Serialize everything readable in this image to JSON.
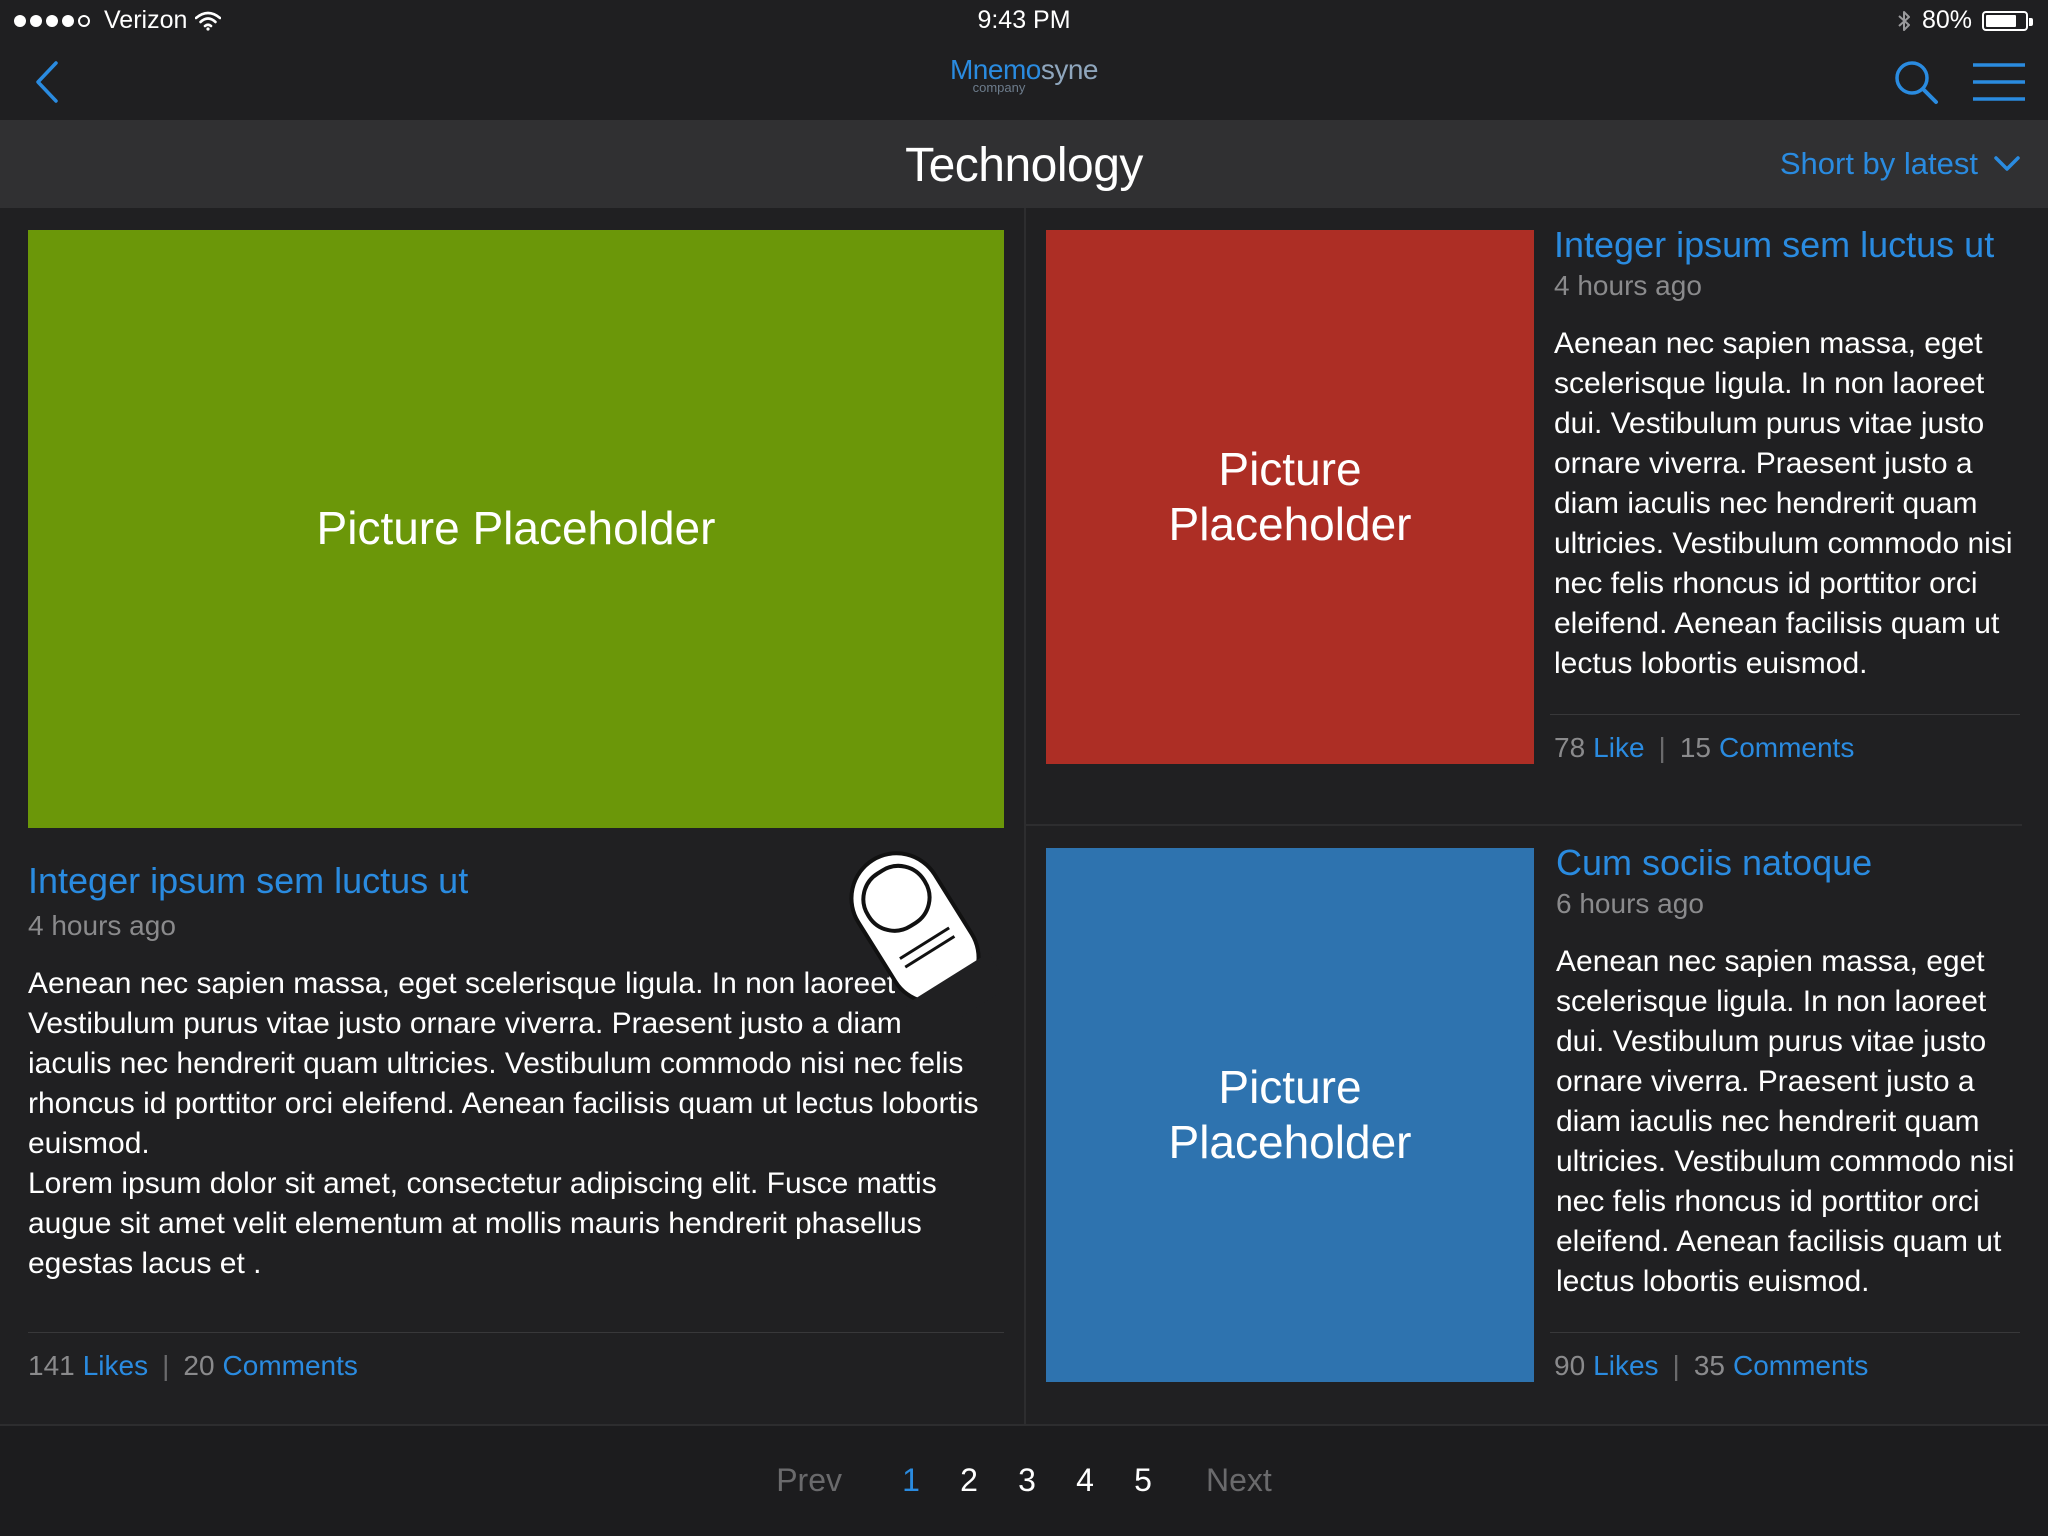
{
  "status_bar": {
    "carrier": "Verizon",
    "time": "9:43 PM",
    "battery": "80%",
    "battery_level": 0.8,
    "signal_bars_filled": 4,
    "icons": [
      "signal-dots-icon",
      "wifi-icon",
      "bluetooth-icon",
      "battery-icon"
    ]
  },
  "nav": {
    "logo_part1": "Mnemo",
    "logo_part2": "syne",
    "logo_sub": "company",
    "icons": [
      "back-chevron-icon",
      "search-icon",
      "hamburger-menu-icon"
    ]
  },
  "section": {
    "title": "Technology",
    "sort_label": "Short by latest",
    "sort_icon": "chevron-down-icon"
  },
  "featured": {
    "placeholder": "Picture Placeholder",
    "title": "Integer ipsum sem luctus ut",
    "time": "4 hours ago",
    "body1": "Aenean nec sapien massa, eget scelerisque ligula. In non laoreet Vestibulum purus vitae justo ornare viverra. Praesent justo a diam iaculis nec hendrerit quam ultricies. Vestibulum commodo nisi nec felis rhoncus id porttitor orci eleifend. Aenean facilisis quam ut lectus lobortis euismod.",
    "body2": "Lorem ipsum dolor sit amet, consectetur adipiscing elit. Fusce mattis augue sit amet velit elementum at mollis mauris hendrerit phasellus egestas lacus et .",
    "likes_count": "141",
    "likes_label": "Likes",
    "comments_count": "20",
    "comments_label": "Comments",
    "color": "#6b9709"
  },
  "articles": [
    {
      "placeholder": "Picture Placeholder",
      "title": "Integer ipsum sem luctus ut",
      "time": "4 hours ago",
      "body": "Aenean nec sapien massa, eget scelerisque ligula. In non laoreet dui. Vestibulum purus vitae justo ornare viverra. Praesent justo a diam iaculis nec hendrerit quam ultricies. Vestibulum commodo nisi nec felis rhoncus id porttitor orci eleifend. Aenean facilisis quam ut lectus lobortis euismod.",
      "likes_count": "78",
      "likes_label": "Like",
      "comments_count": "15",
      "comments_label": "Comments",
      "color": "#ad2e25"
    },
    {
      "placeholder": "Picture Placeholder",
      "title": "Cum sociis natoque",
      "time": "6 hours ago",
      "body": "Aenean nec sapien massa, eget scelerisque ligula. In non laoreet dui. Vestibulum purus vitae justo ornare viverra. Praesent justo a diam iaculis nec hendrerit quam ultricies. Vestibulum commodo nisi nec felis rhoncus id porttitor orci eleifend. Aenean facilisis quam ut lectus lobortis euismod.",
      "likes_count": "90",
      "likes_label": "Likes",
      "comments_count": "35",
      "comments_label": "Comments",
      "color": "#2e73af"
    }
  ],
  "pagination": {
    "prev": "Prev",
    "pages": [
      "1",
      "2",
      "3",
      "4",
      "5"
    ],
    "active_page": "1",
    "next": "Next"
  },
  "colors": {
    "accent": "#2a8be0",
    "background": "#202022",
    "header_bar": "#303032"
  }
}
